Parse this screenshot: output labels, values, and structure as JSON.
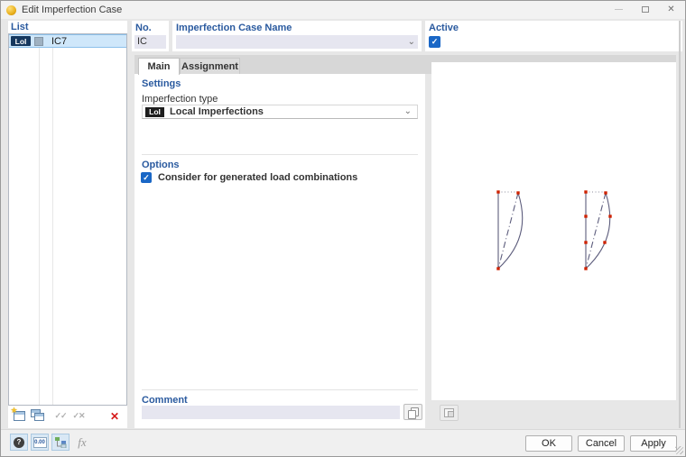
{
  "window": {
    "title": "Edit Imperfection Case"
  },
  "list_panel": {
    "header": "List",
    "items": [
      {
        "badge": "LoI",
        "name": "IC7",
        "selected": true
      }
    ]
  },
  "header_fields": {
    "no": {
      "label": "No.",
      "value": "IC"
    },
    "case_name": {
      "label": "Imperfection Case Name",
      "value": ""
    },
    "active": {
      "label": "Active",
      "checked": true
    }
  },
  "tabs": [
    {
      "label": "Main",
      "active": true
    },
    {
      "label": "Assignment",
      "active": false
    }
  ],
  "settings": {
    "header": "Settings",
    "imperfection_type_label": "Imperfection type",
    "imperfection_type_badge": "LoI",
    "imperfection_type_value": "Local Imperfections"
  },
  "options": {
    "header": "Options",
    "consider_label": "Consider for generated load combinations",
    "checked": true
  },
  "comment": {
    "header": "Comment",
    "value": ""
  },
  "footer_buttons": {
    "ok": "OK",
    "cancel": "Cancel",
    "apply": "Apply"
  },
  "icons": {
    "chevron_down": "⌄",
    "check": "✓",
    "close": "✕",
    "star": "★",
    "double_check": "✓✓",
    "check_cross": "✓✕",
    "delete_x": "✕",
    "help": "?",
    "units_text": "0.00",
    "fx": "fx"
  },
  "colors": {
    "header_blue": "#2a5a9f",
    "selection_bg": "#cfe7fa",
    "badge_navy": "#15375e",
    "badge_black": "#1e1e1e",
    "checkbox_blue": "#1a67c6",
    "diagram_line": "#5c5c7c",
    "diagram_node": "#cf2200"
  }
}
